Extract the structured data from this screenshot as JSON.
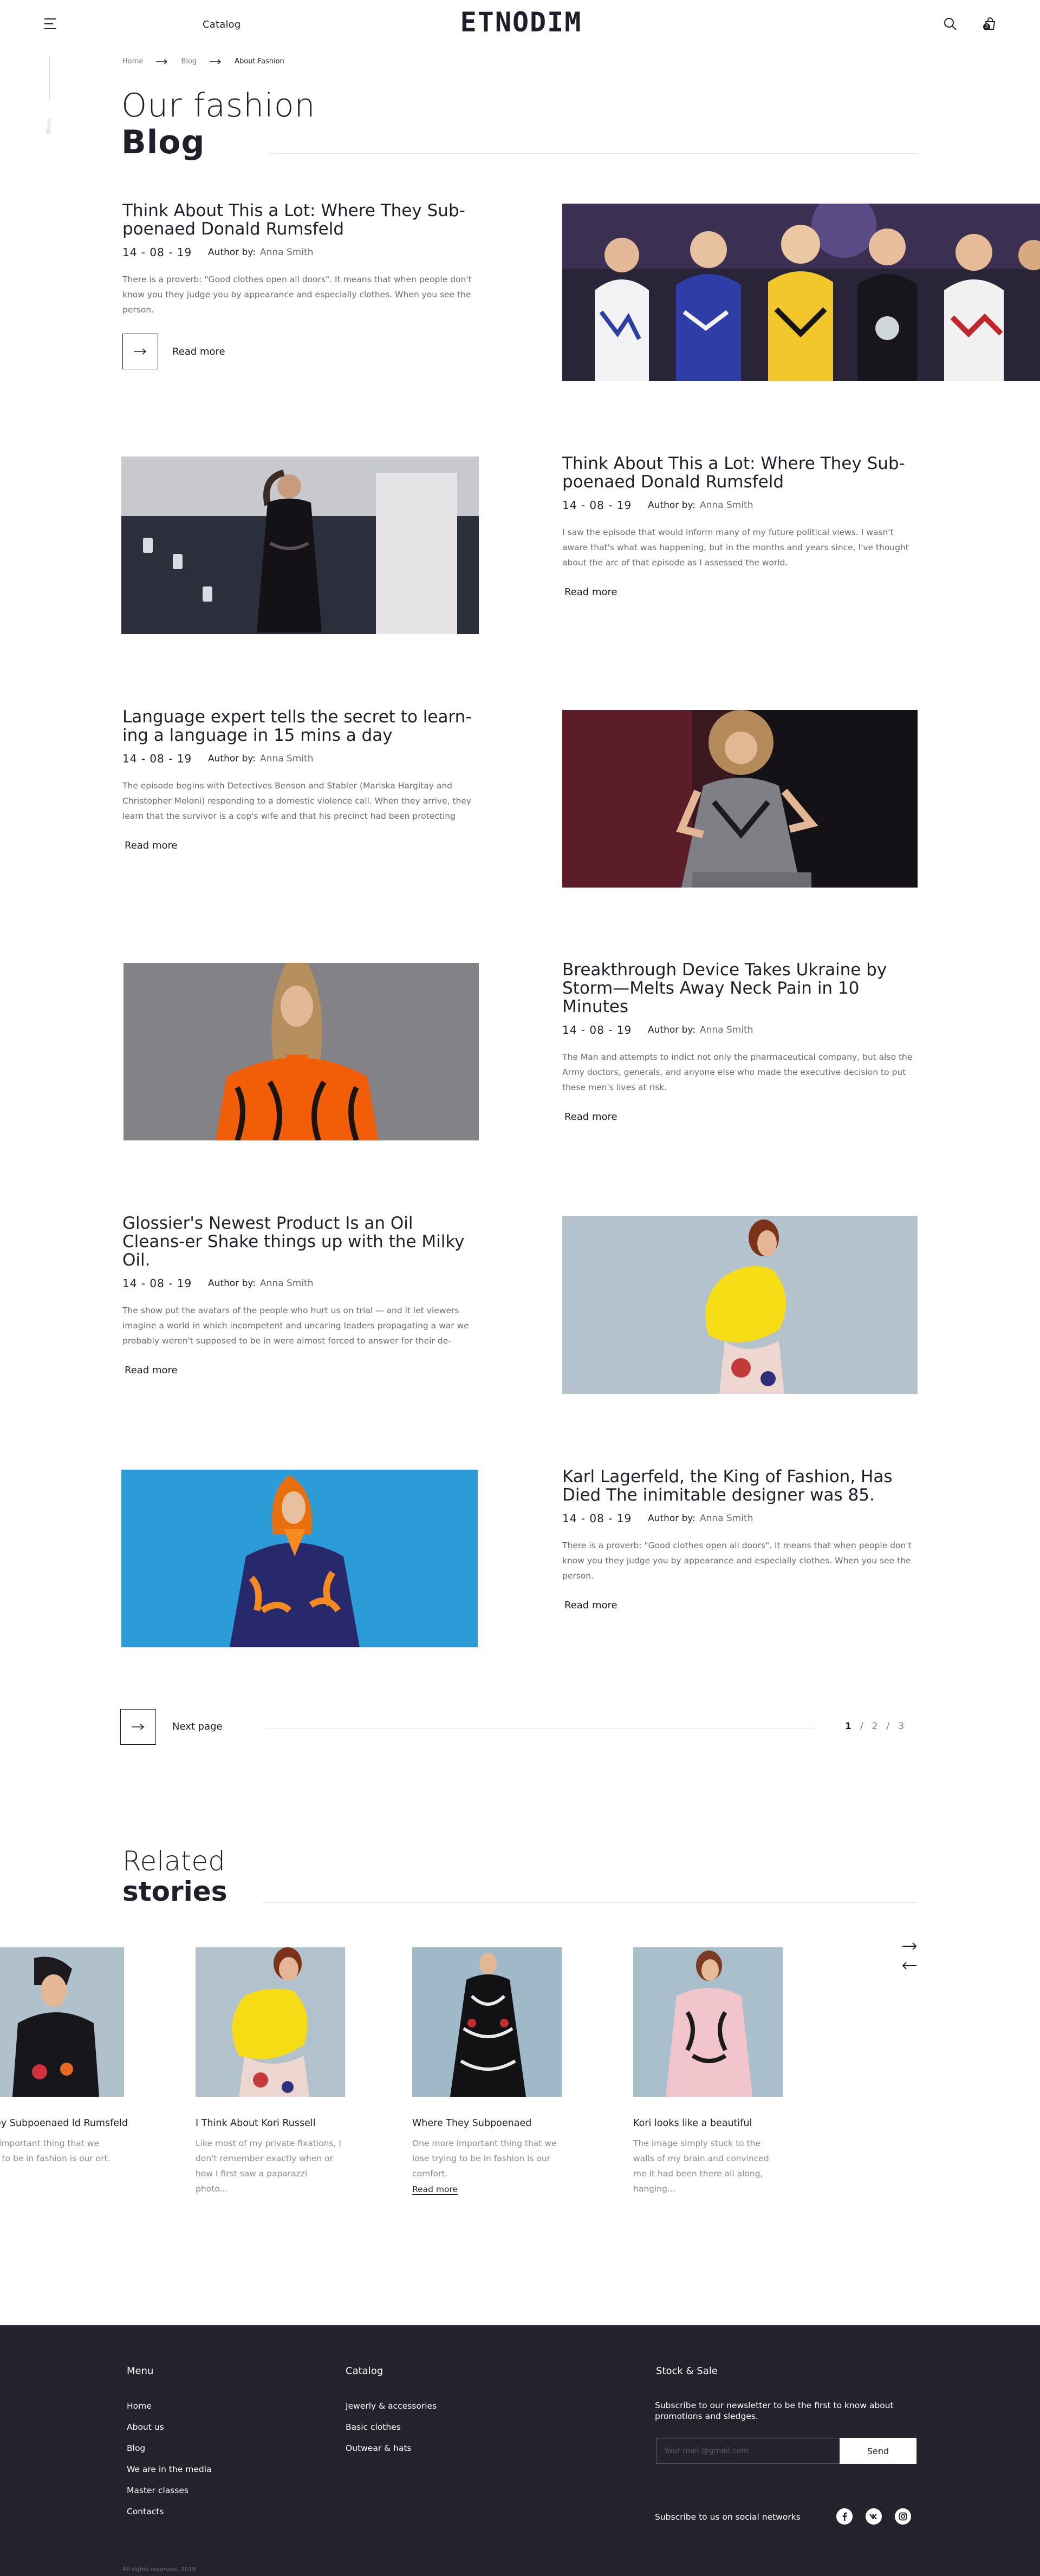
{
  "header": {
    "catalog_label": "Catalog",
    "logo_text": "ETNODIM",
    "cart_count": "3",
    "side_label": "Menu"
  },
  "breadcrumb": {
    "home": "Home",
    "blog": "Blog",
    "current": "About Fashion"
  },
  "page_title": {
    "line1": "Our  fashion",
    "line2": "Blog"
  },
  "posts": [
    {
      "title": "Think About This a Lot: Where They Sub-poenaed Donald Rumsfeld",
      "date": "14 - 08 - 19",
      "author_label": "Author by:",
      "author": "Anna Smith",
      "excerpt": "There is a proverb: \"Good clothes open all doors\". It means that when people don't know you they judge you by appearance and especially clothes. When you see the person.",
      "read_more": "Read more"
    },
    {
      "title": "Think About This a Lot: Where They Sub-poenaed Donald Rumsfeld",
      "date": "14 - 08 - 19",
      "author_label": "Author by:",
      "author": "Anna Smith",
      "excerpt": "I saw the episode that would inform many of my future political views. I wasn't aware that's what was happening, but in the months and years since, I've thought about the arc of that episode as I assessed the world.",
      "read_more": "Read more"
    },
    {
      "title": "Language expert tells the secret to learn-ing a language in 15 mins a day",
      "date": "14 - 08 - 19",
      "author_label": "Author by:",
      "author": "Anna Smith",
      "excerpt": "The episode begins with Detectives Benson and Stabler (Mariska Hargitay and Christopher Meloni) responding to a domestic violence call. When they arrive, they learn that the survivor is a cop's wife and that his precinct had been protecting",
      "read_more": "Read more"
    },
    {
      "title": "Breakthrough Device Takes Ukraine by Storm—Melts Away Neck Pain in 10 Minutes",
      "date": "14 - 08 - 19",
      "author_label": "Author by:",
      "author": "Anna Smith",
      "excerpt": "The Man and attempts to indict not only the pharmaceutical company, but also the Army doctors, generals, and anyone else who made the executive decision to put these men's lives at risk.",
      "read_more": "Read more"
    },
    {
      "title": "Glossier's Newest Product Is an Oil Cleans-er Shake things up with the Milky Oil.",
      "date": "14 - 08 - 19",
      "author_label": "Author by:",
      "author": "Anna Smith",
      "excerpt": "The show put the avatars of the people who hurt us on trial — and it let viewers imagine a world in which incompetent and uncaring leaders propagating a war we probably weren't supposed to be in were almost forced to answer for their de-",
      "read_more": "Read more"
    },
    {
      "title": "Karl Lagerfeld, the King of Fashion, Has Died The inimitable designer was 85.",
      "date": "14 - 08 - 19",
      "author_label": "Author by:",
      "author": "Anna Smith",
      "excerpt": "There is a proverb: \"Good clothes open all doors\". It means that when people don't know you they judge you by appearance and especially clothes. When you see the person.",
      "read_more": "Read more"
    }
  ],
  "pagination": {
    "next_label": "Next page",
    "page1": "1",
    "sep1": "/",
    "page2": "2",
    "sep2": "/",
    "page3": "3"
  },
  "related": {
    "title_line1": "Related",
    "title_line2": "stories",
    "stories": [
      {
        "title": "e They Subpoenaed ld Rumsfeld",
        "excerpt": "more important thing that we trying to be in fashion is our ort."
      },
      {
        "title": "I Think About Kori Russell",
        "excerpt": "Like most of my private fixations, I don't remember exactly when or how I first saw a paparazzi photo..."
      },
      {
        "title": "Where They Subpoenaed",
        "excerpt": "One more important thing that we lose trying to be in fashion is our comfort.",
        "read_more": "Read more"
      },
      {
        "title": "Kori looks like a beautiful",
        "excerpt": "The image simply stuck to the walls of my brain and convinced me it had been there all along, hanging..."
      }
    ]
  },
  "footer": {
    "menu_title": "Menu",
    "menu_items": [
      "Home",
      "About us",
      "Blog",
      "We are in the media",
      "Master classes",
      "Contacts"
    ],
    "catalog_title": "Catalog",
    "catalog_items": [
      "Jewerly & accessories",
      "Basic clothes",
      "Outwear & hats"
    ],
    "stock_title": "Stock & Sale",
    "stock_text": "Subscribe to our newsletter to be the first to know about promotions and sledges.",
    "email_placeholder": "Your mail @gmail.com",
    "send_label": "Send",
    "social_text": "Subscribe to us on social networks",
    "copyright": "All rights reserved, 2019"
  }
}
